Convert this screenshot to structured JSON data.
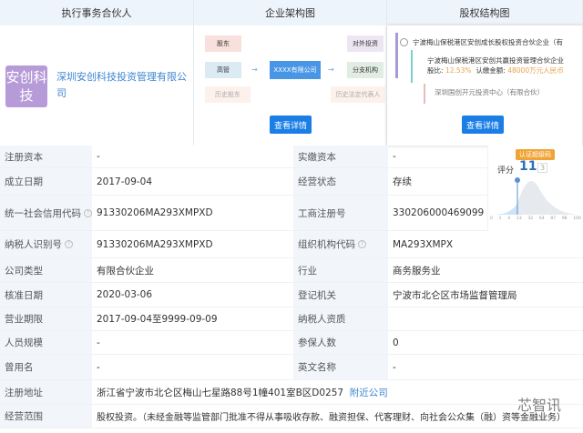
{
  "headers": [
    "执行事务合伙人",
    "企业架构图",
    "股权结构图"
  ],
  "partner": {
    "logo_text": "安创科技",
    "name": "深圳安创科技投资管理有限公司"
  },
  "structure": {
    "shareholder": "股东",
    "executive": "高管",
    "history_shareholder": "历史股东",
    "company": "XXXX有限公司",
    "investment": "对外投资",
    "branch": "分支机构",
    "history_legal": "历史法定代表人",
    "button": "查看详情"
  },
  "equity": {
    "node1": "宁波梅山保税港区安创成长股权投资合伙企业（有",
    "node2": "宁波梅山保税港区安创共赢投资管理合伙企业",
    "node2_ratio_label": "股比:",
    "node2_ratio": "12.53%",
    "node2_amount_label": "认缴金额:",
    "node2_amount": "48000万元人民币",
    "node3": "深圳国创开元投资中心（有限合伙）",
    "button": "查看详情"
  },
  "score": {
    "badge": "认证超级码",
    "label": "评分",
    "value": "11",
    "rank": "3",
    "ticks": [
      "0",
      "1",
      "4",
      "13",
      "32",
      "64",
      "87",
      "98",
      "100"
    ]
  },
  "rows": [
    {
      "l1": "注册资本",
      "v1": "-",
      "l2": "实缴资本",
      "v2": "-"
    },
    {
      "l1": "成立日期",
      "v1": "2017-09-04",
      "l2": "经营状态",
      "v2": "存续"
    },
    {
      "l1": "统一社会信用代码",
      "v1": "91330206MA293XMPXD",
      "l2": "工商注册号",
      "v2": "330206000469099"
    },
    {
      "l1": "纳税人识别号",
      "v1": "91330206MA293XMPXD",
      "l2": "组织机构代码",
      "v2": "MA293XMPX"
    },
    {
      "l1": "公司类型",
      "v1": "有限合伙企业",
      "l2": "行业",
      "v2": "商务服务业"
    },
    {
      "l1": "核准日期",
      "v1": "2020-03-06",
      "l2": "登记机关",
      "v2": "宁波市北仑区市场监督管理局"
    },
    {
      "l1": "营业期限",
      "v1": "2017-09-04至9999-09-09",
      "l2": "纳税人资质",
      "v2": ""
    },
    {
      "l1": "人员规模",
      "v1": "-",
      "l2": "参保人数",
      "v2": "0"
    },
    {
      "l1": "曾用名",
      "v1": "-",
      "l2": "英文名称",
      "v2": "-"
    }
  ],
  "address": {
    "label": "注册地址",
    "value": "浙江省宁波市北仑区梅山七星路88号1幢401室B区D0257",
    "link": "附近公司"
  },
  "scope": {
    "label": "经营范围",
    "value": "股权投资。（未经金融等监管部门批准不得从事吸收存款、融资担保、代客理财、向社会公众集（融）资等金融业务）"
  },
  "watermark": "芯智讯"
}
